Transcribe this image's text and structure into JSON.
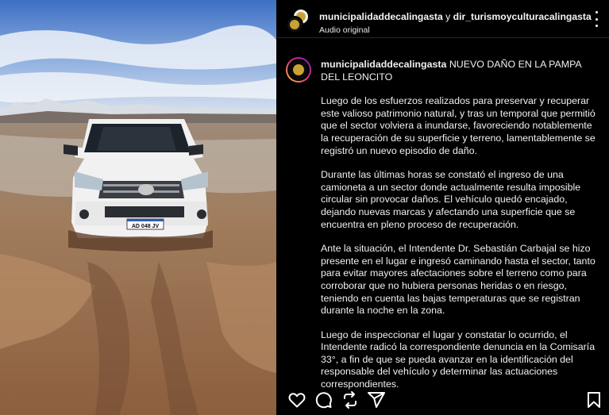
{
  "header": {
    "user1": "municipalidaddecalingasta",
    "conjunction": " y ",
    "user2": "dir_turismoyculturacalingasta",
    "audio": "Audio original"
  },
  "caption": {
    "username": "municipalidaddecalingasta",
    "title": " NUEVO DAÑO EN LA PAMPA DEL LEONCITO",
    "paragraphs": [
      "Luego de los esfuerzos realizados para preservar y recuperar este valioso patrimonio natural, y tras un temporal que permitió que el sector volviera a inundarse, favoreciendo notablemente la recuperación de su superficie y terreno, lamentablemente se registró un nuevo episodio de daño.",
      "Durante las últimas horas se constató el ingreso de una camioneta a un sector donde actualmente resulta imposible circular sin provocar daños. El vehículo quedó encajado, dejando nuevas marcas y afectando una superficie que se encuentra en pleno proceso de recuperación.",
      "Ante la situación, el Intendente Dr. Sebastián Carbajal se hizo presente en el lugar e ingresó caminando hasta el sector, tanto para evitar mayores afectaciones sobre el terreno como para corroborar que no hubiera personas heridas o en riesgo, teniendo en cuenta las bajas temperaturas que se registran durante la noche en la zona.",
      "Luego de inspeccionar el lugar y constatar lo ocurrido, el Intendente radicó la correspondiente denuncia en la Comisaría 33°, a fin de que se pueda avanzar en la identificación del responsable del vehículo y determinar las actuaciones correspondientes."
    ]
  },
  "media": {
    "plate": "AD 048 JV",
    "description_icons": [
      "toyota-logo"
    ]
  },
  "actions": {
    "icons": [
      "heart-icon",
      "comment-icon",
      "repost-icon",
      "share-icon",
      "bookmark-icon"
    ]
  },
  "colors": {
    "background": "#000000",
    "text": "#f5f5f5",
    "accent_logo": "#caa233"
  }
}
